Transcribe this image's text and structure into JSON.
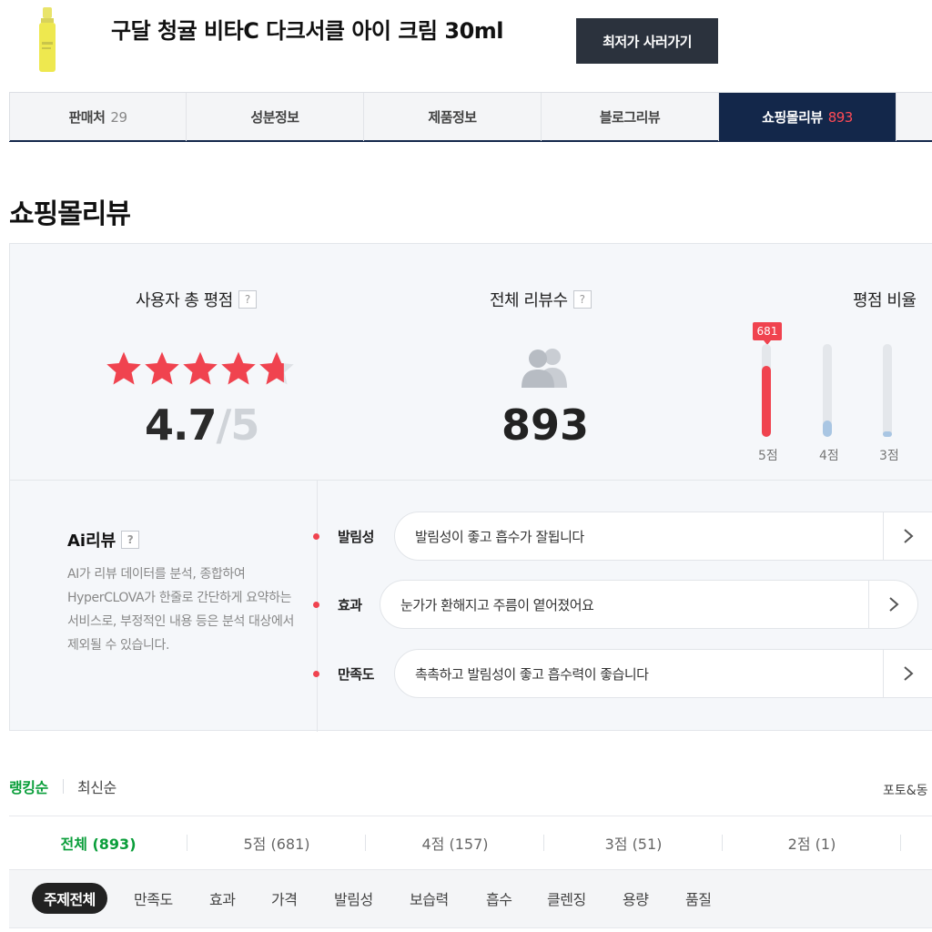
{
  "product": {
    "title": "구달 청귤 비타C 다크서클 아이 크림 30ml",
    "buy_button": "최저가 사러가기"
  },
  "tabs": [
    {
      "label": "판매처",
      "count": "29",
      "active": false
    },
    {
      "label": "성분정보",
      "count": "",
      "active": false
    },
    {
      "label": "제품정보",
      "count": "",
      "active": false
    },
    {
      "label": "블로그리뷰",
      "count": "",
      "active": false
    },
    {
      "label": "쇼핑몰리뷰",
      "count": "893",
      "active": true
    }
  ],
  "section_title": "쇼핑몰리뷰",
  "summary": {
    "rating_label": "사용자 총 평점",
    "rating_value": "4.7",
    "rating_slash": "/",
    "rating_max": "5",
    "rating_score": 4.7,
    "review_count_label": "전체 리뷰수",
    "review_count": "893",
    "ratio_label": "평점 비율",
    "ratio_badge": "681",
    "ratio_bars": [
      {
        "label": "5점",
        "fraction": 0.76,
        "color": "#f0434f"
      },
      {
        "label": "4점",
        "fraction": 0.18,
        "color": "#a9c6e3"
      },
      {
        "label": "3점",
        "fraction": 0.06,
        "color": "#a9c6e3"
      }
    ],
    "help_icon": "?"
  },
  "ai_review": {
    "title": "Ai리뷰",
    "description": "AI가 리뷰 데이터를 분석, 종합하여 HyperCLOVA가 한줄로 간단하게 요약하는 서비스로, 부정적인 내용 등은 분석 대상에서 제외될 수 있습니다.",
    "topics": [
      {
        "name": "발림성",
        "summary": "발림성이 좋고 흡수가 잘됩니다"
      },
      {
        "name": "효과",
        "summary": "눈가가 환해지고 주름이 옅어졌어요"
      },
      {
        "name": "만족도",
        "summary": "촉촉하고 발림성이 좋고 흡수력이 좋습니다"
      }
    ]
  },
  "sort": {
    "options": [
      "랭킹순",
      "최신순"
    ],
    "active": "랭킹순",
    "photo_filter": "포토&동"
  },
  "score_tabs": [
    {
      "label": "전체 (893)",
      "active": true
    },
    {
      "label": "5점 (681)",
      "active": false
    },
    {
      "label": "4점 (157)",
      "active": false
    },
    {
      "label": "3점 (51)",
      "active": false
    },
    {
      "label": "2점 (1)",
      "active": false
    }
  ],
  "topic_filters": [
    "주제전체",
    "만족도",
    "효과",
    "가격",
    "발림성",
    "보습력",
    "흡수",
    "클렌징",
    "용량",
    "품질"
  ],
  "colors": {
    "navy": "#13274a",
    "accent_red": "#f0434f",
    "green": "#0a9e3a",
    "dark_button": "#2b323d"
  }
}
